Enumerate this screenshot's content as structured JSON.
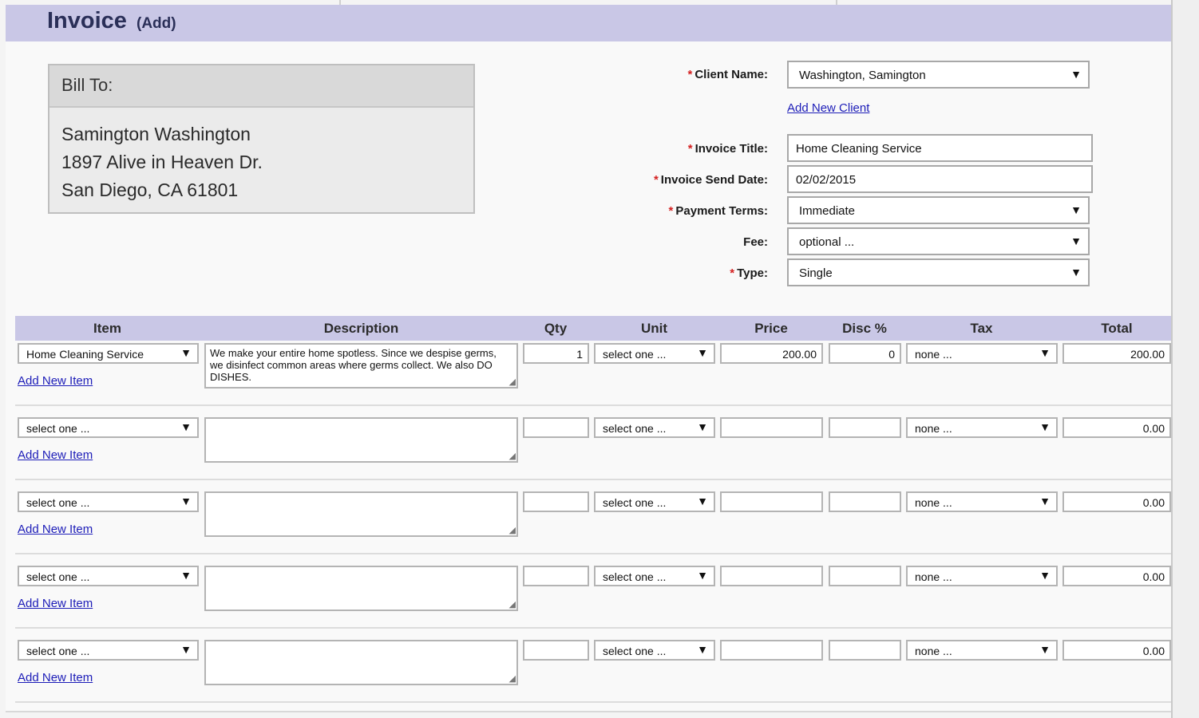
{
  "header": {
    "title": "Invoice",
    "subtitle": "(Add)"
  },
  "bill_to": {
    "heading": "Bill To:",
    "name": "Samington Washington",
    "address1": "1897 Alive in Heaven Dr.",
    "address2": "San Diego, CA 61801"
  },
  "form": {
    "client_name_label": "Client Name:",
    "client_name_value": "Washington, Samington",
    "add_new_client": "Add New Client",
    "invoice_title_label": "Invoice Title:",
    "invoice_title_value": "Home Cleaning Service",
    "send_date_label": "Invoice Send Date:",
    "send_date_value": "02/02/2015",
    "payment_terms_label": "Payment Terms:",
    "payment_terms_value": "Immediate",
    "fee_label": "Fee:",
    "fee_value": "optional ...",
    "type_label": "Type:",
    "type_value": "Single",
    "required_marker": "*"
  },
  "table": {
    "headers": [
      "Item",
      "Description",
      "Qty",
      "Unit",
      "Price",
      "Disc %",
      "Tax",
      "Total"
    ],
    "add_new_item": "Add New Item",
    "rows": [
      {
        "item": "Home Cleaning Service",
        "description": "We make your entire home spotless. Since we despise germs, we disinfect common areas where germs collect. We also DO DISHES.",
        "qty": "1",
        "unit": "select one ...",
        "price": "200.00",
        "disc": "0",
        "tax": "none ...",
        "total": "200.00"
      },
      {
        "item": "select one ...",
        "description": "",
        "qty": "",
        "unit": "select one ...",
        "price": "",
        "disc": "",
        "tax": "none ...",
        "total": "0.00"
      },
      {
        "item": "select one ...",
        "description": "",
        "qty": "",
        "unit": "select one ...",
        "price": "",
        "disc": "",
        "tax": "none ...",
        "total": "0.00"
      },
      {
        "item": "select one ...",
        "description": "",
        "qty": "",
        "unit": "select one ...",
        "price": "",
        "disc": "",
        "tax": "none ...",
        "total": "0.00"
      },
      {
        "item": "select one ...",
        "description": "",
        "qty": "",
        "unit": "select one ...",
        "price": "",
        "disc": "",
        "tax": "none ...",
        "total": "0.00"
      }
    ]
  },
  "icons": {
    "dropdown": "▼",
    "delete": "✖",
    "resize": "◢"
  },
  "colors": {
    "header_band": "#c9c7e6",
    "link": "#1d1db8",
    "required": "#d42020"
  }
}
